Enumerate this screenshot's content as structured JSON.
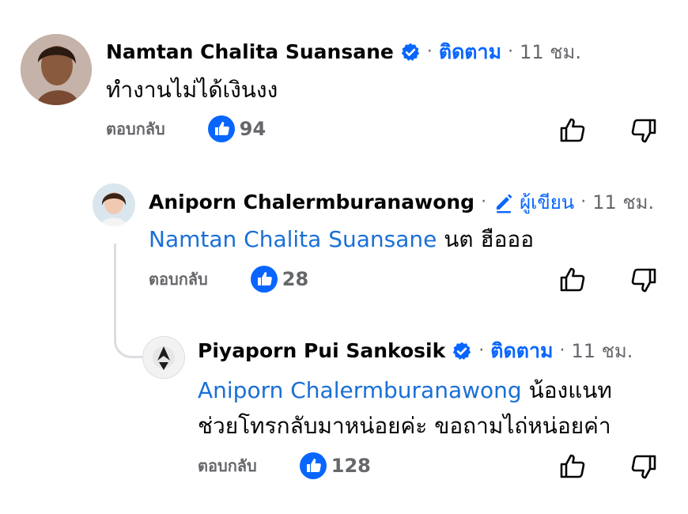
{
  "comments": [
    {
      "name": "Namtan Chalita Suansane",
      "badge_icon": "verified-badge-icon",
      "follow_label": "ติดตาม",
      "time": "11 ชม.",
      "text": "ทำงานไม่ได้เงินงง",
      "reply_label": "ตอบกลับ",
      "like_count": "94"
    },
    {
      "name": "Aniporn Chalermburanawong",
      "author_icon": "pencil-icon",
      "author_label": "ผู้เขียน",
      "time": "11 ชม.",
      "mention": "Namtan Chalita Suansane",
      "text": "นต ฮือออ",
      "reply_label": "ตอบกลับ",
      "like_count": "28"
    },
    {
      "name": "Piyaporn Pui Sankosik",
      "badge_icon": "verified-badge-icon",
      "follow_label": "ติดตาม",
      "time": "11 ชม.",
      "mention": "Aniporn Chalermburanawong",
      "text_line1": "น้องแนท",
      "text_line2": "ช่วยโทรกลับมาหน่อยค่ะ ขอถามไถ่หน่อยค่า",
      "reply_label": "ตอบกลับ",
      "like_count": "128"
    }
  ],
  "colors": {
    "link": "#0866ff",
    "mention": "#1a6fd6",
    "meta": "#65676b",
    "thread_line": "#dadde1"
  }
}
